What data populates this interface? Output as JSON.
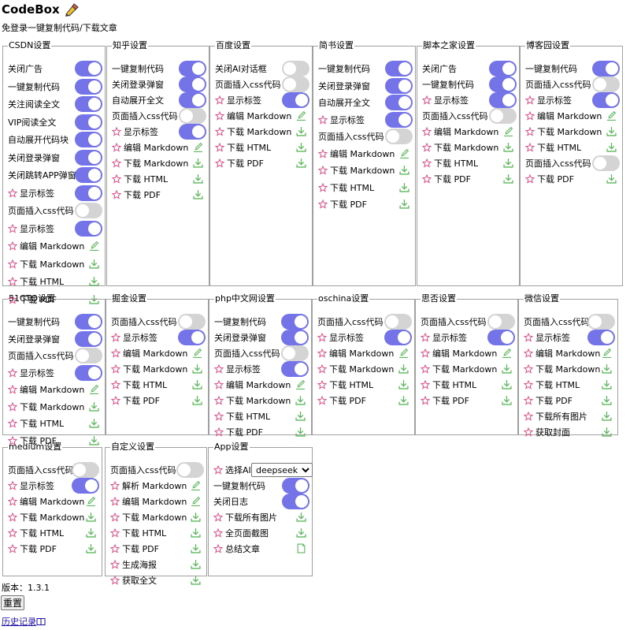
{
  "header": {
    "title": "CodeBox",
    "subtitle": "免登录一键复制代码/下载文章"
  },
  "colors": {
    "toggle_on": "#7474e8",
    "toggle_off": "#d4d4d4",
    "star": "#e0508a",
    "download": "#5cb85c"
  },
  "panels": [
    {
      "name": "csdn",
      "legend": "CSDN设置",
      "items": [
        {
          "label": "关闭广告",
          "type": "toggle",
          "on": true
        },
        {
          "label": "一键复制代码",
          "type": "toggle",
          "on": true
        },
        {
          "label": "关注阅读全文",
          "type": "toggle",
          "on": true
        },
        {
          "label": "VIP阅读全文",
          "type": "toggle",
          "on": true
        },
        {
          "label": "自动展开代码块",
          "type": "toggle",
          "on": true
        },
        {
          "label": "关闭登录弹窗",
          "type": "toggle",
          "on": true
        },
        {
          "label": "关闭跳转APP弹窗",
          "type": "toggle",
          "on": true
        },
        {
          "label": "显示标签",
          "type": "star-toggle",
          "on": true
        },
        {
          "label": "页面插入css代码",
          "type": "toggle",
          "on": false
        },
        {
          "label": "显示标签",
          "type": "star-toggle",
          "on": true
        },
        {
          "label": "编辑 Markdown",
          "type": "edit"
        },
        {
          "label": "下载 Markdown",
          "type": "download"
        },
        {
          "label": "下载 HTML",
          "type": "download"
        },
        {
          "label": "下载 PDF",
          "type": "download"
        }
      ]
    },
    {
      "name": "zhihu",
      "legend": "知乎设置",
      "items": [
        {
          "label": "一键复制代码",
          "type": "toggle",
          "on": true
        },
        {
          "label": "关闭登录弹窗",
          "type": "toggle",
          "on": true
        },
        {
          "label": "自动展开全文",
          "type": "toggle",
          "on": true
        },
        {
          "label": "页面插入css代码",
          "type": "toggle",
          "on": false
        },
        {
          "label": "显示标签",
          "type": "star-toggle",
          "on": true
        },
        {
          "label": "编辑 Markdown",
          "type": "edit"
        },
        {
          "label": "下载 Markdown",
          "type": "download"
        },
        {
          "label": "下载 HTML",
          "type": "download"
        },
        {
          "label": "下载 PDF",
          "type": "download"
        }
      ]
    },
    {
      "name": "baidu",
      "legend": "百度设置",
      "items": [
        {
          "label": "关闭AI对话框",
          "type": "toggle",
          "on": false
        },
        {
          "label": "页面插入css代码",
          "type": "toggle",
          "on": false
        },
        {
          "label": "显示标签",
          "type": "star-toggle",
          "on": true
        },
        {
          "label": "编辑 Markdown",
          "type": "edit"
        },
        {
          "label": "下载 Markdown",
          "type": "download"
        },
        {
          "label": "下载 HTML",
          "type": "download"
        },
        {
          "label": "下载 PDF",
          "type": "download"
        }
      ]
    },
    {
      "name": "jianshu",
      "legend": "简书设置",
      "items": [
        {
          "label": "一键复制代码",
          "type": "toggle",
          "on": true
        },
        {
          "label": "关闭登录弹窗",
          "type": "toggle",
          "on": true
        },
        {
          "label": "自动展开全文",
          "type": "toggle",
          "on": true
        },
        {
          "label": "显示标签",
          "type": "star-toggle",
          "on": true
        },
        {
          "label": "页面插入css代码",
          "type": "toggle",
          "on": false
        },
        {
          "label": "编辑 Markdown",
          "type": "edit"
        },
        {
          "label": "下载 Markdown",
          "type": "download"
        },
        {
          "label": "下载 HTML",
          "type": "download"
        },
        {
          "label": "下载 PDF",
          "type": "download"
        }
      ]
    },
    {
      "name": "jb51",
      "legend": "脚本之家设置",
      "items": [
        {
          "label": "关闭广告",
          "type": "toggle",
          "on": true
        },
        {
          "label": "一键复制代码",
          "type": "toggle",
          "on": true
        },
        {
          "label": "显示标签",
          "type": "star-toggle",
          "on": true
        },
        {
          "label": "页面插入css代码",
          "type": "toggle",
          "on": false
        },
        {
          "label": "编辑 Markdown",
          "type": "edit"
        },
        {
          "label": "下载 Markdown",
          "type": "download"
        },
        {
          "label": "下载 HTML",
          "type": "download"
        },
        {
          "label": "下载 PDF",
          "type": "download"
        }
      ]
    },
    {
      "name": "cnblogs",
      "legend": "博客园设置",
      "items": [
        {
          "label": "一键复制代码",
          "type": "toggle",
          "on": true
        },
        {
          "label": "页面插入css代码",
          "type": "toggle",
          "on": false
        },
        {
          "label": "显示标签",
          "type": "star-toggle",
          "on": true
        },
        {
          "label": "编辑 Markdown",
          "type": "edit"
        },
        {
          "label": "下载 Markdown",
          "type": "download"
        },
        {
          "label": "下载 HTML",
          "type": "download"
        },
        {
          "label": "页面插入css代码",
          "type": "toggle",
          "on": false
        },
        {
          "label": "下载 PDF",
          "type": "download"
        }
      ]
    },
    {
      "name": "cto51",
      "legend": "51CTO设置",
      "items": [
        {
          "label": "一键复制代码",
          "type": "toggle",
          "on": true
        },
        {
          "label": "关闭登录弹窗",
          "type": "toggle",
          "on": true
        },
        {
          "label": "页面插入css代码",
          "type": "toggle",
          "on": false
        },
        {
          "label": "显示标签",
          "type": "star-toggle",
          "on": true
        },
        {
          "label": "编辑 Markdown",
          "type": "edit"
        },
        {
          "label": "下载 Markdown",
          "type": "download"
        },
        {
          "label": "下载 HTML",
          "type": "download"
        },
        {
          "label": "下载 PDF",
          "type": "download"
        }
      ]
    },
    {
      "name": "juejin",
      "legend": "掘金设置",
      "items": [
        {
          "label": "页面插入css代码",
          "type": "toggle",
          "on": false
        },
        {
          "label": "显示标签",
          "type": "star-toggle",
          "on": true
        },
        {
          "label": "编辑 Markdown",
          "type": "edit"
        },
        {
          "label": "下载 Markdown",
          "type": "download"
        },
        {
          "label": "下载 HTML",
          "type": "download"
        },
        {
          "label": "下载 PDF",
          "type": "download"
        }
      ]
    },
    {
      "name": "php",
      "legend": "php中文网设置",
      "items": [
        {
          "label": "一键复制代码",
          "type": "toggle",
          "on": true
        },
        {
          "label": "关闭登录弹窗",
          "type": "toggle",
          "on": true
        },
        {
          "label": "页面插入css代码",
          "type": "toggle",
          "on": false
        },
        {
          "label": "显示标签",
          "type": "star-toggle",
          "on": true
        },
        {
          "label": "编辑 Markdown",
          "type": "edit"
        },
        {
          "label": "下载 Markdown",
          "type": "download"
        },
        {
          "label": "下载 HTML",
          "type": "download"
        },
        {
          "label": "下载 PDF",
          "type": "download"
        }
      ]
    },
    {
      "name": "oschina",
      "legend": "oschina设置",
      "items": [
        {
          "label": "页面插入css代码",
          "type": "toggle",
          "on": false
        },
        {
          "label": "显示标签",
          "type": "star-toggle",
          "on": true
        },
        {
          "label": "编辑 Markdown",
          "type": "edit"
        },
        {
          "label": "下载 Markdown",
          "type": "download"
        },
        {
          "label": "下载 HTML",
          "type": "download"
        },
        {
          "label": "下载 PDF",
          "type": "download"
        }
      ]
    },
    {
      "name": "sifou",
      "legend": "思否设置",
      "items": [
        {
          "label": "页面插入css代码",
          "type": "toggle",
          "on": false
        },
        {
          "label": "显示标签",
          "type": "star-toggle",
          "on": true
        },
        {
          "label": "编辑 Markdown",
          "type": "edit"
        },
        {
          "label": "下载 Markdown",
          "type": "download"
        },
        {
          "label": "下载 HTML",
          "type": "download"
        },
        {
          "label": "下载 PDF",
          "type": "download"
        }
      ]
    },
    {
      "name": "weixin",
      "legend": "微信设置",
      "items": [
        {
          "label": "页面插入css代码",
          "type": "toggle",
          "on": false
        },
        {
          "label": "显示标签",
          "type": "star-toggle",
          "on": true
        },
        {
          "label": "编辑 Markdown",
          "type": "edit"
        },
        {
          "label": "下载 Markdown",
          "type": "download"
        },
        {
          "label": "下载 HTML",
          "type": "download"
        },
        {
          "label": "下载 PDF",
          "type": "download"
        },
        {
          "label": "下载所有图片",
          "type": "download"
        },
        {
          "label": "获取封面",
          "type": "download"
        }
      ]
    },
    {
      "name": "medium",
      "legend": "medium设置",
      "items": [
        {
          "label": "页面插入css代码",
          "type": "toggle",
          "on": false
        },
        {
          "label": "显示标签",
          "type": "star-toggle",
          "on": true
        },
        {
          "label": "编辑 Markdown",
          "type": "edit"
        },
        {
          "label": "下载 Markdown",
          "type": "download"
        },
        {
          "label": "下载 HTML",
          "type": "download"
        },
        {
          "label": "下载 PDF",
          "type": "download"
        }
      ]
    },
    {
      "name": "custom",
      "legend": "自定义设置",
      "items": [
        {
          "label": "页面插入css代码",
          "type": "toggle",
          "on": false
        },
        {
          "label": "解析 Markdown",
          "type": "edit"
        },
        {
          "label": "编辑 Markdown",
          "type": "edit"
        },
        {
          "label": "下载 Markdown",
          "type": "download"
        },
        {
          "label": "下载 HTML",
          "type": "download"
        },
        {
          "label": "下载 PDF",
          "type": "download"
        },
        {
          "label": "生成海报",
          "type": "download"
        },
        {
          "label": "获取全文",
          "type": "download"
        }
      ]
    },
    {
      "name": "app",
      "legend": "App设置",
      "items": [
        {
          "label": "选择AI",
          "type": "star-select",
          "value": "deepseek"
        },
        {
          "label": "一键复制代码",
          "type": "toggle",
          "on": true
        },
        {
          "label": "关闭日志",
          "type": "toggle",
          "on": true
        },
        {
          "label": "下载所有图片",
          "type": "download"
        },
        {
          "label": "全页面截图",
          "type": "download"
        },
        {
          "label": "总结文章",
          "type": "doc"
        }
      ]
    }
  ],
  "footer": {
    "version": "版本：1.3.1",
    "reset_label": "重置",
    "history_label": "历史记录"
  }
}
